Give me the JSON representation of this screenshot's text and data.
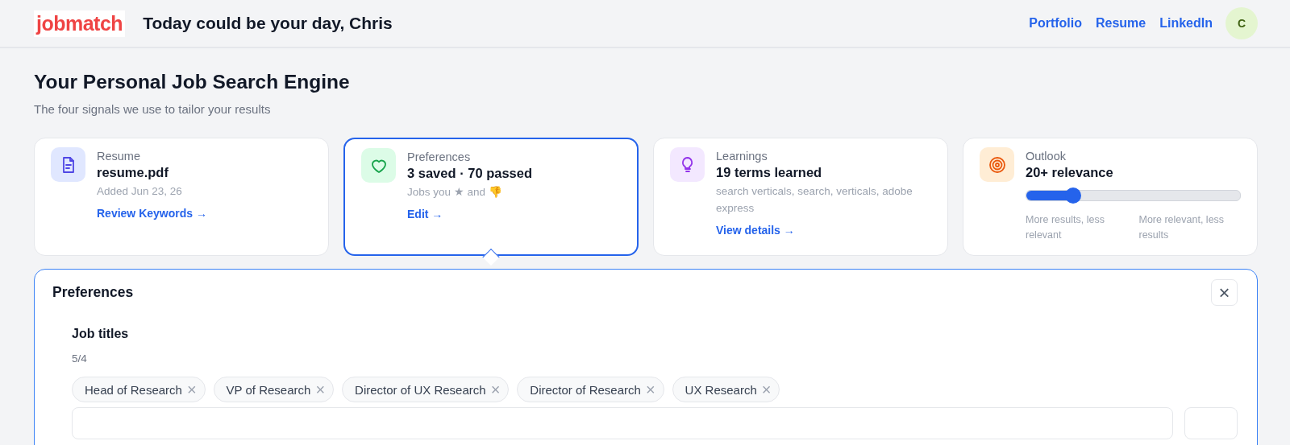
{
  "header": {
    "logo": "jobmatch",
    "greeting": "Today could be your day, Chris",
    "links": [
      "Portfolio",
      "Resume",
      "LinkedIn"
    ],
    "avatar": "C"
  },
  "page": {
    "title": "Your Personal Job Search Engine",
    "subtitle": "The four signals we use to tailor your results"
  },
  "cards": [
    {
      "kind": "resume",
      "label": "Resume",
      "value": "resume.pdf",
      "detail": "Added Jun 23, 26",
      "link": "Review Keywords →",
      "selected": false
    },
    {
      "kind": "preferences",
      "label": "Preferences",
      "value": "3 saved · 70 passed",
      "detail": "Jobs you ★ and 👎",
      "link": "Edit →",
      "selected": true
    },
    {
      "kind": "learnings",
      "label": "Learnings",
      "value": "19 terms learned",
      "detail": "search verticals, search, verticals, adobe express",
      "link": "View details →",
      "selected": false
    },
    {
      "kind": "outlook",
      "label": "Outlook",
      "value": "20+ relevance",
      "level": 0.22,
      "low_label": "More results, less relevant",
      "high_label": "More relevant, less results",
      "selected": false
    }
  ],
  "panel": {
    "title": "Preferences",
    "close": "×",
    "section": "Job titles",
    "count": "5/4",
    "chips": [
      {
        "label": "Head of Research",
        "remove": "×"
      },
      {
        "label": "VP of Research",
        "remove": "×"
      },
      {
        "label": "Director of UX Research",
        "remove": "×"
      },
      {
        "label": "Director of Research",
        "remove": "×"
      },
      {
        "label": "UX Research",
        "remove": "×"
      }
    ]
  }
}
